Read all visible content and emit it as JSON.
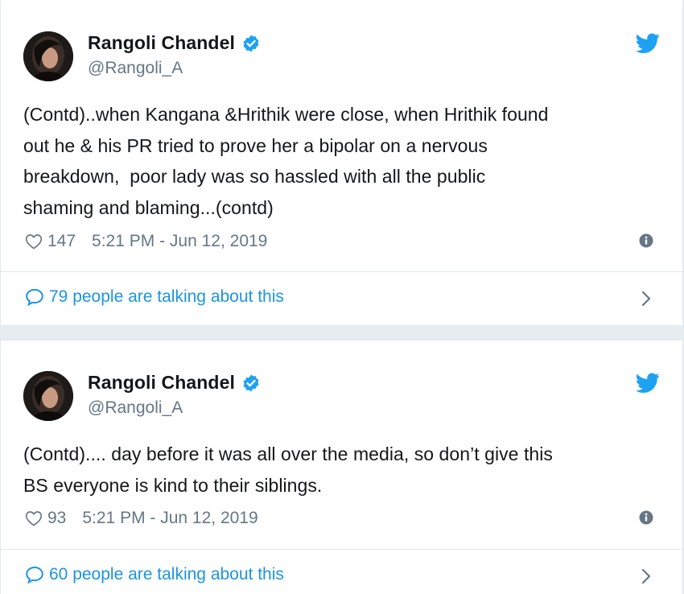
{
  "tweets": [
    {
      "display_name": "Rangoli Chandel",
      "handle": "@Rangoli_A",
      "text": "(Contd)..when Kangana &Hrithik were close, when Hrithik found\nout he & his PR tried to prove her a bipolar on a nervous\nbreakdown,  poor lady was so hassled with all the public\nshaming and blaming...(contd)",
      "likes": "147",
      "timestamp": "5:21 PM - Jun 12, 2019",
      "talking": "79 people are talking about this"
    },
    {
      "display_name": "Rangoli Chandel",
      "handle": "@Rangoli_A",
      "text": "(Contd).... day before it was all over the media, so don’t give this\nBS everyone is kind to their siblings.",
      "likes": "93",
      "timestamp": "5:21 PM - Jun 12, 2019",
      "talking": "60 people are talking about this"
    }
  ],
  "icons": {
    "verified": "verified-badge-icon",
    "bird": "twitter-bird-icon",
    "heart": "heart-icon",
    "info": "info-icon",
    "bubble": "speech-bubble-icon",
    "chevron": "chevron-right-icon"
  },
  "colors": {
    "accent": "#1da1f2",
    "link": "#1b95e0",
    "muted": "#657786",
    "text": "#14171a"
  }
}
